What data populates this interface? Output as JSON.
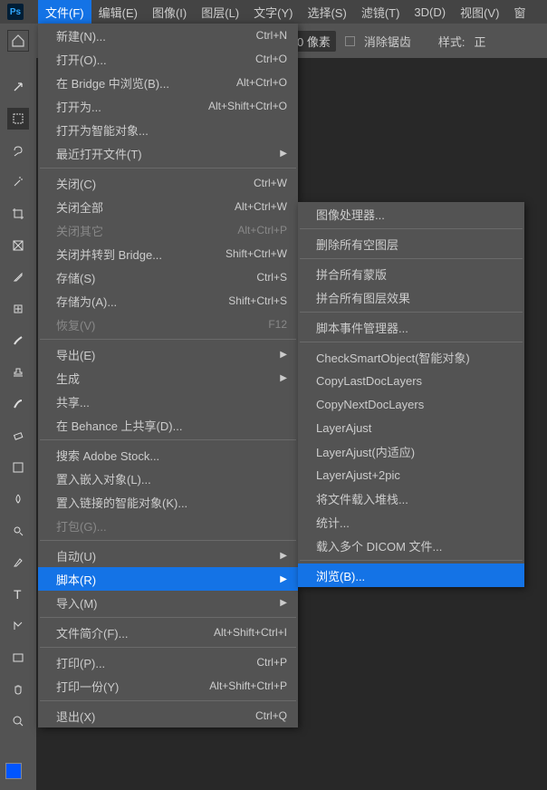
{
  "app_icon": "Ps",
  "menubar": [
    "文件(F)",
    "编辑(E)",
    "图像(I)",
    "图层(L)",
    "文字(Y)",
    "选择(S)",
    "滤镜(T)",
    "3D(D)",
    "视图(V)",
    "窗"
  ],
  "optbar": {
    "px_value": "0 像素",
    "antialias": "消除锯齿",
    "style": "样式:",
    "norm": "正"
  },
  "file_menu": [
    {
      "type": "item",
      "label": "新建(N)...",
      "shortcut": "Ctrl+N"
    },
    {
      "type": "item",
      "label": "打开(O)...",
      "shortcut": "Ctrl+O"
    },
    {
      "type": "item",
      "label": "在 Bridge 中浏览(B)...",
      "shortcut": "Alt+Ctrl+O"
    },
    {
      "type": "item",
      "label": "打开为...",
      "shortcut": "Alt+Shift+Ctrl+O"
    },
    {
      "type": "item",
      "label": "打开为智能对象..."
    },
    {
      "type": "submenu",
      "label": "最近打开文件(T)"
    },
    {
      "type": "sep"
    },
    {
      "type": "item",
      "label": "关闭(C)",
      "shortcut": "Ctrl+W"
    },
    {
      "type": "item",
      "label": "关闭全部",
      "shortcut": "Alt+Ctrl+W"
    },
    {
      "type": "item",
      "label": "关闭其它",
      "shortcut": "Alt+Ctrl+P",
      "disabled": true
    },
    {
      "type": "item",
      "label": "关闭并转到 Bridge...",
      "shortcut": "Shift+Ctrl+W"
    },
    {
      "type": "item",
      "label": "存储(S)",
      "shortcut": "Ctrl+S"
    },
    {
      "type": "item",
      "label": "存储为(A)...",
      "shortcut": "Shift+Ctrl+S"
    },
    {
      "type": "item",
      "label": "恢复(V)",
      "shortcut": "F12",
      "disabled": true
    },
    {
      "type": "sep"
    },
    {
      "type": "submenu",
      "label": "导出(E)"
    },
    {
      "type": "submenu",
      "label": "生成"
    },
    {
      "type": "item",
      "label": "共享..."
    },
    {
      "type": "item",
      "label": "在 Behance 上共享(D)..."
    },
    {
      "type": "sep"
    },
    {
      "type": "item",
      "label": "搜索 Adobe Stock..."
    },
    {
      "type": "item",
      "label": "置入嵌入对象(L)..."
    },
    {
      "type": "item",
      "label": "置入链接的智能对象(K)..."
    },
    {
      "type": "item",
      "label": "打包(G)...",
      "disabled": true
    },
    {
      "type": "sep"
    },
    {
      "type": "submenu",
      "label": "自动(U)"
    },
    {
      "type": "submenu",
      "label": "脚本(R)",
      "highlight": true
    },
    {
      "type": "submenu",
      "label": "导入(M)"
    },
    {
      "type": "sep"
    },
    {
      "type": "item",
      "label": "文件简介(F)...",
      "shortcut": "Alt+Shift+Ctrl+I"
    },
    {
      "type": "sep"
    },
    {
      "type": "item",
      "label": "打印(P)...",
      "shortcut": "Ctrl+P"
    },
    {
      "type": "item",
      "label": "打印一份(Y)",
      "shortcut": "Alt+Shift+Ctrl+P"
    },
    {
      "type": "sep"
    },
    {
      "type": "item",
      "label": "退出(X)",
      "shortcut": "Ctrl+Q"
    }
  ],
  "scripts_menu": [
    {
      "type": "item",
      "label": "图像处理器..."
    },
    {
      "type": "sep"
    },
    {
      "type": "item",
      "label": "删除所有空图层"
    },
    {
      "type": "sep"
    },
    {
      "type": "item",
      "label": "拼合所有蒙版"
    },
    {
      "type": "item",
      "label": "拼合所有图层效果"
    },
    {
      "type": "sep"
    },
    {
      "type": "item",
      "label": "脚本事件管理器..."
    },
    {
      "type": "sep"
    },
    {
      "type": "item",
      "label": "CheckSmartObject(智能对象)"
    },
    {
      "type": "item",
      "label": "CopyLastDocLayers"
    },
    {
      "type": "item",
      "label": "CopyNextDocLayers"
    },
    {
      "type": "item",
      "label": "LayerAjust"
    },
    {
      "type": "item",
      "label": "LayerAjust(内适应)"
    },
    {
      "type": "item",
      "label": "LayerAjust+2pic"
    },
    {
      "type": "item",
      "label": "将文件载入堆栈..."
    },
    {
      "type": "item",
      "label": "统计..."
    },
    {
      "type": "item",
      "label": "载入多个 DICOM 文件..."
    },
    {
      "type": "sep"
    },
    {
      "type": "item",
      "label": "浏览(B)...",
      "highlight": true
    }
  ],
  "tools": [
    "move",
    "marquee",
    "lasso",
    "magic",
    "crop",
    "frame",
    "eyedropper",
    "heal",
    "brush",
    "stamp",
    "history",
    "eraser",
    "gradient",
    "blur",
    "dodge",
    "pen",
    "type",
    "path",
    "rect",
    "hand",
    "zoom"
  ]
}
